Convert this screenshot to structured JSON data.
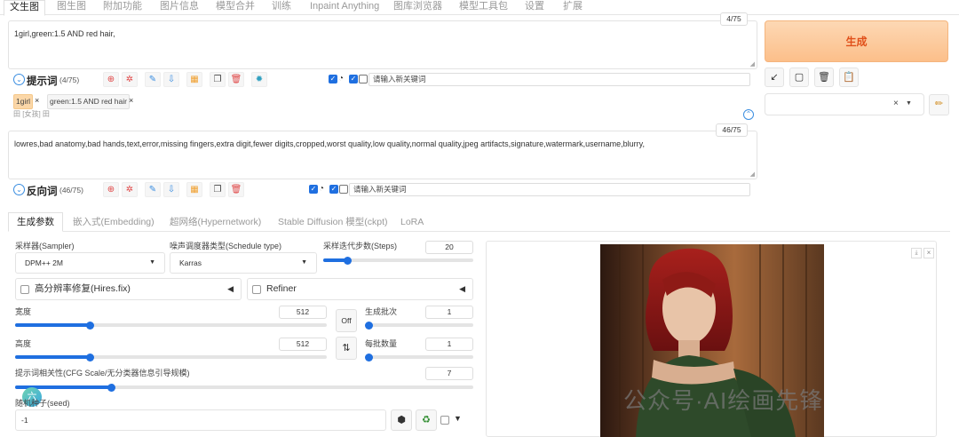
{
  "top_tabs": [
    "文生图",
    "图生图",
    "附加功能",
    "图片信息",
    "模型合并",
    "训练",
    "Inpaint Anything",
    "图库浏览器",
    "模型工具包",
    "设置",
    "扩展"
  ],
  "prompt": {
    "text": "1girl,green:1.5 AND red hair,",
    "counter": "4/75",
    "label": "提示词",
    "count": "(4/75)",
    "keyword_placeholder": "请输入新关键词",
    "tags": [
      "1girl",
      "green:1.5 AND red hair"
    ],
    "tag_close": "×",
    "hint_row": "田 [女孩]  田"
  },
  "negative": {
    "text": "lowres,bad anatomy,bad hands,text,error,missing fingers,extra digit,fewer digits,cropped,worst quality,low quality,normal quality,jpeg artifacts,signature,watermark,username,blurry,",
    "counter": "46/75",
    "label": "反向词",
    "count": "(46/75)",
    "keyword_placeholder": "请输入新关键词"
  },
  "generate": {
    "label": "生成",
    "clear_value": "×"
  },
  "param_tabs": [
    "生成参数",
    "嵌入式(Embedding)",
    "超网络(Hypernetwork)",
    "Stable Diffusion 模型(ckpt)",
    "LoRA"
  ],
  "params": {
    "sampler_label": "采样器(Sampler)",
    "sampler_value": "DPM++ 2M",
    "schedule_label": "噪声调度器类型(Schedule type)",
    "schedule_value": "Karras",
    "steps_label": "采样迭代步数(Steps)",
    "steps_value": "20",
    "steps_fraction": 0.16,
    "hires_label": "高分辨率修复(Hires.fix)",
    "refiner_label": "Refiner",
    "width_label": "宽度",
    "width_value": "512",
    "width_fraction": 0.24,
    "height_label": "高度",
    "height_value": "512",
    "height_fraction": 0.24,
    "swap_off_label": "Off",
    "batch_count_label": "生成批次",
    "batch_count_value": "1",
    "batch_count_fraction": 0.0,
    "batch_size_label": "每批数量",
    "batch_size_value": "1",
    "batch_size_fraction": 0.0,
    "cfg_label": "提示词相关性(CFG Scale/无分类器信息引导规模)",
    "cfg_value": "7",
    "cfg_fraction": 0.21,
    "seed_label": "随机种子(seed)",
    "seed_value": "-1"
  },
  "watermark": "公众号·AI绘画先锋",
  "avatar_char": "六",
  "colors": {
    "accent": "#1f6fe0",
    "generate_text": "#e0501a"
  }
}
